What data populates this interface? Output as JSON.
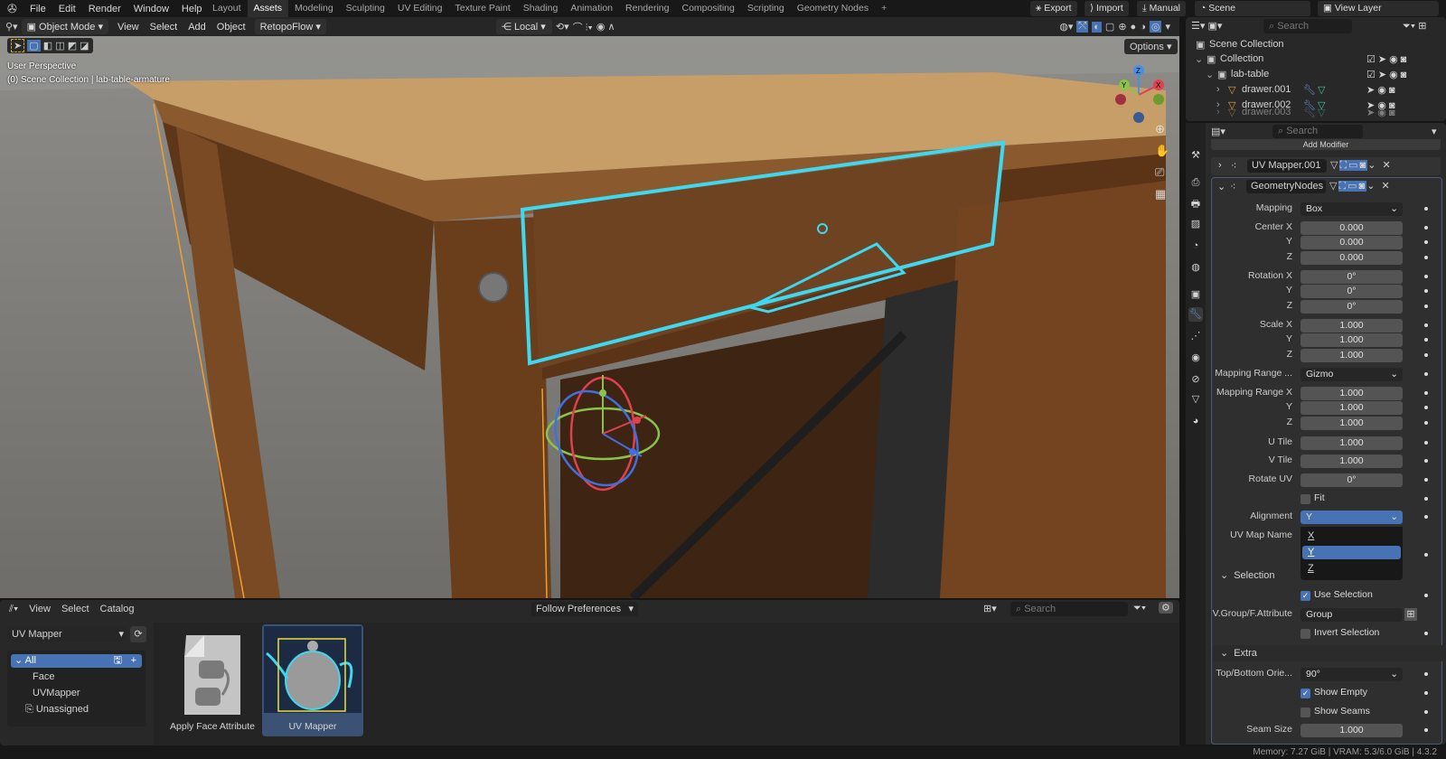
{
  "topbar": {
    "menus": [
      "File",
      "Edit",
      "Render",
      "Window",
      "Help"
    ],
    "workspaces": [
      "Layout",
      "Assets",
      "Modeling",
      "Sculpting",
      "UV Editing",
      "Texture Paint",
      "Shading",
      "Animation",
      "Rendering",
      "Compositing",
      "Scripting",
      "Geometry Nodes"
    ],
    "active_workspace": "Assets",
    "add_workspace": "+",
    "export": "Export",
    "import": "Import",
    "manual": "Manual",
    "scene": "Scene",
    "view_layer": "View Layer"
  },
  "viewport_header": {
    "mode": "Object Mode",
    "menus": [
      "View",
      "Select",
      "Add",
      "Object"
    ],
    "addon": "RetopoFlow",
    "orientation": "Local",
    "options": "Options"
  },
  "viewport": {
    "perspective": "User Perspective",
    "collection_info": "(0) Scene Collection | lab-table-armature",
    "axes": {
      "x": "X",
      "y": "Y",
      "z": "Z"
    },
    "colors": {
      "selection_outline": "#3fd8f0",
      "active_outline": "#f0a030"
    }
  },
  "outliner": {
    "search_placeholder": "Search",
    "items": [
      {
        "label": "Scene Collection",
        "icon": "scene-collection-icon"
      },
      {
        "label": "Collection",
        "icon": "collection-icon"
      },
      {
        "label": "lab-table",
        "icon": "collection-icon"
      },
      {
        "label": "drawer.001",
        "icon": "mesh-icon"
      },
      {
        "label": "drawer.002",
        "icon": "mesh-icon"
      },
      {
        "label": "drawer.003",
        "icon": "mesh-icon"
      }
    ]
  },
  "properties": {
    "search_placeholder": "Search",
    "add_modifier": "Add Modifier",
    "modifiers": [
      {
        "name": "UV Mapper.001",
        "expanded": false
      },
      {
        "name": "GeometryNodes",
        "expanded": true
      }
    ],
    "rows": [
      {
        "type": "dropdown",
        "label": "Mapping",
        "value": "Box"
      },
      {
        "type": "number",
        "label": "Center X",
        "value": "0.000"
      },
      {
        "type": "number",
        "label": "Y",
        "value": "0.000"
      },
      {
        "type": "number",
        "label": "Z",
        "value": "0.000"
      },
      {
        "type": "number",
        "label": "Rotation X",
        "value": "0°"
      },
      {
        "type": "number",
        "label": "Y",
        "value": "0°"
      },
      {
        "type": "number",
        "label": "Z",
        "value": "0°"
      },
      {
        "type": "number",
        "label": "Scale X",
        "value": "1.000"
      },
      {
        "type": "number",
        "label": "Y",
        "value": "1.000"
      },
      {
        "type": "number",
        "label": "Z",
        "value": "1.000"
      },
      {
        "type": "dropdown",
        "label": "Mapping Range ...",
        "value": "Gizmo"
      },
      {
        "type": "number",
        "label": "Mapping Range X",
        "value": "1.000"
      },
      {
        "type": "number",
        "label": "Y",
        "value": "1.000"
      },
      {
        "type": "number",
        "label": "Z",
        "value": "1.000"
      },
      {
        "type": "number",
        "label": "U Tile",
        "value": "1.000"
      },
      {
        "type": "number",
        "label": "V Tile",
        "value": "1.000"
      },
      {
        "type": "number",
        "label": "Rotate UV",
        "value": "0°"
      },
      {
        "type": "checkbox",
        "label": "Fit",
        "checked": false
      },
      {
        "type": "dropdown-open",
        "label": "Alignment",
        "value": "Y"
      },
      {
        "type": "label",
        "label": "UV Map Name"
      },
      {
        "type": "section",
        "label": "Selection"
      },
      {
        "type": "checkbox",
        "label": "Use Selection",
        "checked": true
      },
      {
        "type": "text",
        "label": "V.Group/F.Attribute",
        "value": "Group"
      },
      {
        "type": "checkbox",
        "label": "Invert Selection",
        "checked": false
      },
      {
        "type": "section",
        "label": "Extra"
      },
      {
        "type": "dropdown",
        "label": "Top/Bottom Orie...",
        "value": "90°"
      },
      {
        "type": "checkbox",
        "label": "Show Empty",
        "checked": true
      },
      {
        "type": "checkbox",
        "label": "Show Seams",
        "checked": false
      },
      {
        "type": "number",
        "label": "Seam Size",
        "value": "1.000"
      }
    ],
    "alignment_options": [
      "X",
      "Y",
      "Z"
    ],
    "alignment_selected": "Y"
  },
  "asset_browser": {
    "menus": [
      "View",
      "Select",
      "Catalog"
    ],
    "library": "UV Mapper",
    "import_method": "Follow Preferences",
    "search_placeholder": "Search",
    "catalogs": [
      {
        "label": "All",
        "active": true
      },
      {
        "label": "Face"
      },
      {
        "label": "UVMapper"
      },
      {
        "label": "Unassigned"
      }
    ],
    "assets": [
      {
        "label": "Apply Face Attribute",
        "selected": false
      },
      {
        "label": "UV Mapper",
        "selected": true
      }
    ]
  },
  "status": {
    "text": "Memory: 7.27 GiB | VRAM: 5.3/6.0 GiB | 4.3.2"
  }
}
